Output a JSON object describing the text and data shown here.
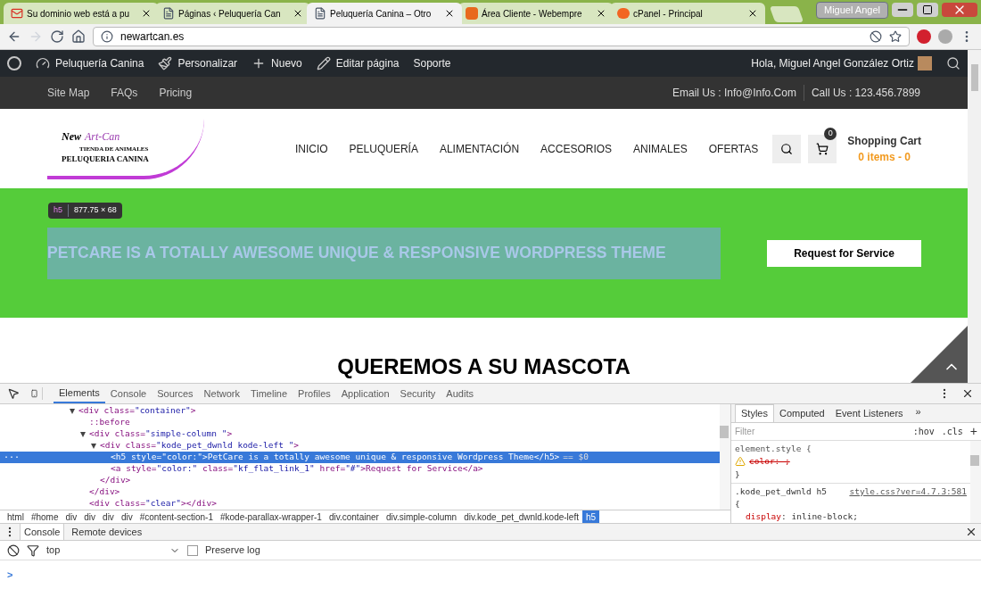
{
  "browser": {
    "tabs": [
      {
        "title": "Su dominio web está a pu",
        "kind": "mail",
        "selected": false
      },
      {
        "title": "Páginas ‹ Peluquería Can",
        "kind": "page",
        "selected": false
      },
      {
        "title": "Peluquería Canina – Otro",
        "kind": "page",
        "selected": true
      },
      {
        "title": "Área Cliente - Webempre",
        "kind": "w",
        "selected": false
      },
      {
        "title": "cPanel - Principal",
        "kind": "cpanel",
        "selected": false
      }
    ],
    "user": "Miguel Angel",
    "url": "newartcan.es"
  },
  "admin_bar": {
    "items": [
      {
        "label": "Peluquería Canina",
        "kind": "gauge"
      },
      {
        "label": "Personalizar",
        "kind": "brush"
      },
      {
        "label": "Nuevo",
        "kind": "plus"
      },
      {
        "label": "Editar página",
        "kind": "pencil"
      },
      {
        "label": "Soporte",
        "kind": "text"
      }
    ],
    "greeting": "Hola, Miguel Angel González Ortiz"
  },
  "top_bar": {
    "links": [
      "Site Map",
      "FAQs",
      "Pricing"
    ],
    "email": "Email Us : Info@Info.Com",
    "phone": "Call Us : 123.456.7899"
  },
  "header": {
    "logo": {
      "brand_a": "New",
      "brand_b": "Art-Can",
      "line_1": "TIENDA DE ANIMALES",
      "line_2": "PELUQUERIA CANINA"
    },
    "nav": [
      "INICIO",
      "PELUQUERÍA",
      "ALIMENTACIÓN",
      "ACCESORIOS",
      "ANIMALES",
      "OFERTAS"
    ],
    "cart_count": "0",
    "cart_title": "Shopping Cart",
    "cart_items": "0 items - 0"
  },
  "hero": {
    "badge_tag": "h5",
    "badge_size": "877.75 × 68",
    "heading": "PETCARE IS A TOTALLY AWESOME UNIQUE & RESPONSIVE WORDPRESS THEME",
    "highlighted": true,
    "button": "Request for Service"
  },
  "section_title": "QUEREMOS A SU MASCOTA",
  "devtools": {
    "tabs": [
      {
        "label": "Elements",
        "selected": true
      },
      {
        "label": "Console",
        "selected": false
      },
      {
        "label": "Sources",
        "selected": false
      },
      {
        "label": "Network",
        "selected": false
      },
      {
        "label": "Timeline",
        "selected": false
      },
      {
        "label": "Profiles",
        "selected": false
      },
      {
        "label": "Application",
        "selected": false
      },
      {
        "label": "Security",
        "selected": false
      },
      {
        "label": "Audits",
        "selected": false
      }
    ],
    "dom": [
      {
        "text": "<div class=\"container\">",
        "expanded": true,
        "selected": false,
        "children": [
          {
            "text": "::before",
            "selected": false
          },
          {
            "text": "<div class=\"simple-column  \">",
            "expanded": true,
            "selected": false,
            "close": "</div>",
            "children": [
              {
                "text": "<div class=\"kode_pet_dwnld kode-left \">",
                "expanded": true,
                "selected": false,
                "close": "</div>",
                "children": [
                  {
                    "text": "<h5 style=\"color:\">PetCare is a totally awesome unique & responsive Wordpress Theme</h5>",
                    "selected": true,
                    "marker": "== $0",
                    "dots": "···"
                  },
                  {
                    "text": "<a style=\"color:\" class=\"kf_flat_link_1\" href=\"#\">Request for Service</a>",
                    "selected": false
                  }
                ]
              }
            ]
          },
          {
            "text": "<div class=\"clear\"></div>",
            "selected": false
          }
        ]
      }
    ],
    "breadcrumb": [
      {
        "label": "html",
        "selected": false
      },
      {
        "label": "#home",
        "selected": false
      },
      {
        "label": "div",
        "selected": false
      },
      {
        "label": "div",
        "selected": false
      },
      {
        "label": "div",
        "selected": false
      },
      {
        "label": "div",
        "selected": false
      },
      {
        "label": "#content-section-1",
        "selected": false
      },
      {
        "label": "#kode-parallax-wrapper-1",
        "selected": false
      },
      {
        "label": "div.container",
        "selected": false
      },
      {
        "label": "div.simple-column",
        "selected": false
      },
      {
        "label": "div.kode_pet_dwnld.kode-left",
        "selected": false
      },
      {
        "label": "h5",
        "selected": true
      }
    ],
    "styles": {
      "tabs": [
        {
          "label": "Styles",
          "selected": true
        },
        {
          "label": "Computed",
          "selected": false
        },
        {
          "label": "Event Listeners",
          "selected": false
        }
      ],
      "more": "»",
      "filter_placeholder": "Filter",
      "hov": ":hov",
      "cls": ".cls",
      "add": "+",
      "rule_1": {
        "selector": "element.style {",
        "property": "color: ;",
        "overridden": true,
        "close": "}"
      },
      "rule_2": {
        "selector": ".kode_pet_dwnld h5",
        "source": "style.css?ver=4.7.3:581",
        "open": "{",
        "property": "display",
        "separator": ":",
        "value": "inline-block;"
      }
    }
  },
  "console": {
    "tabs": [
      {
        "label": "Console",
        "selected": true
      },
      {
        "label": "Remote devices",
        "selected": false
      }
    ],
    "context": "top",
    "preserve_log": {
      "label": "Preserve log",
      "checked": false
    },
    "prompt": ">"
  }
}
